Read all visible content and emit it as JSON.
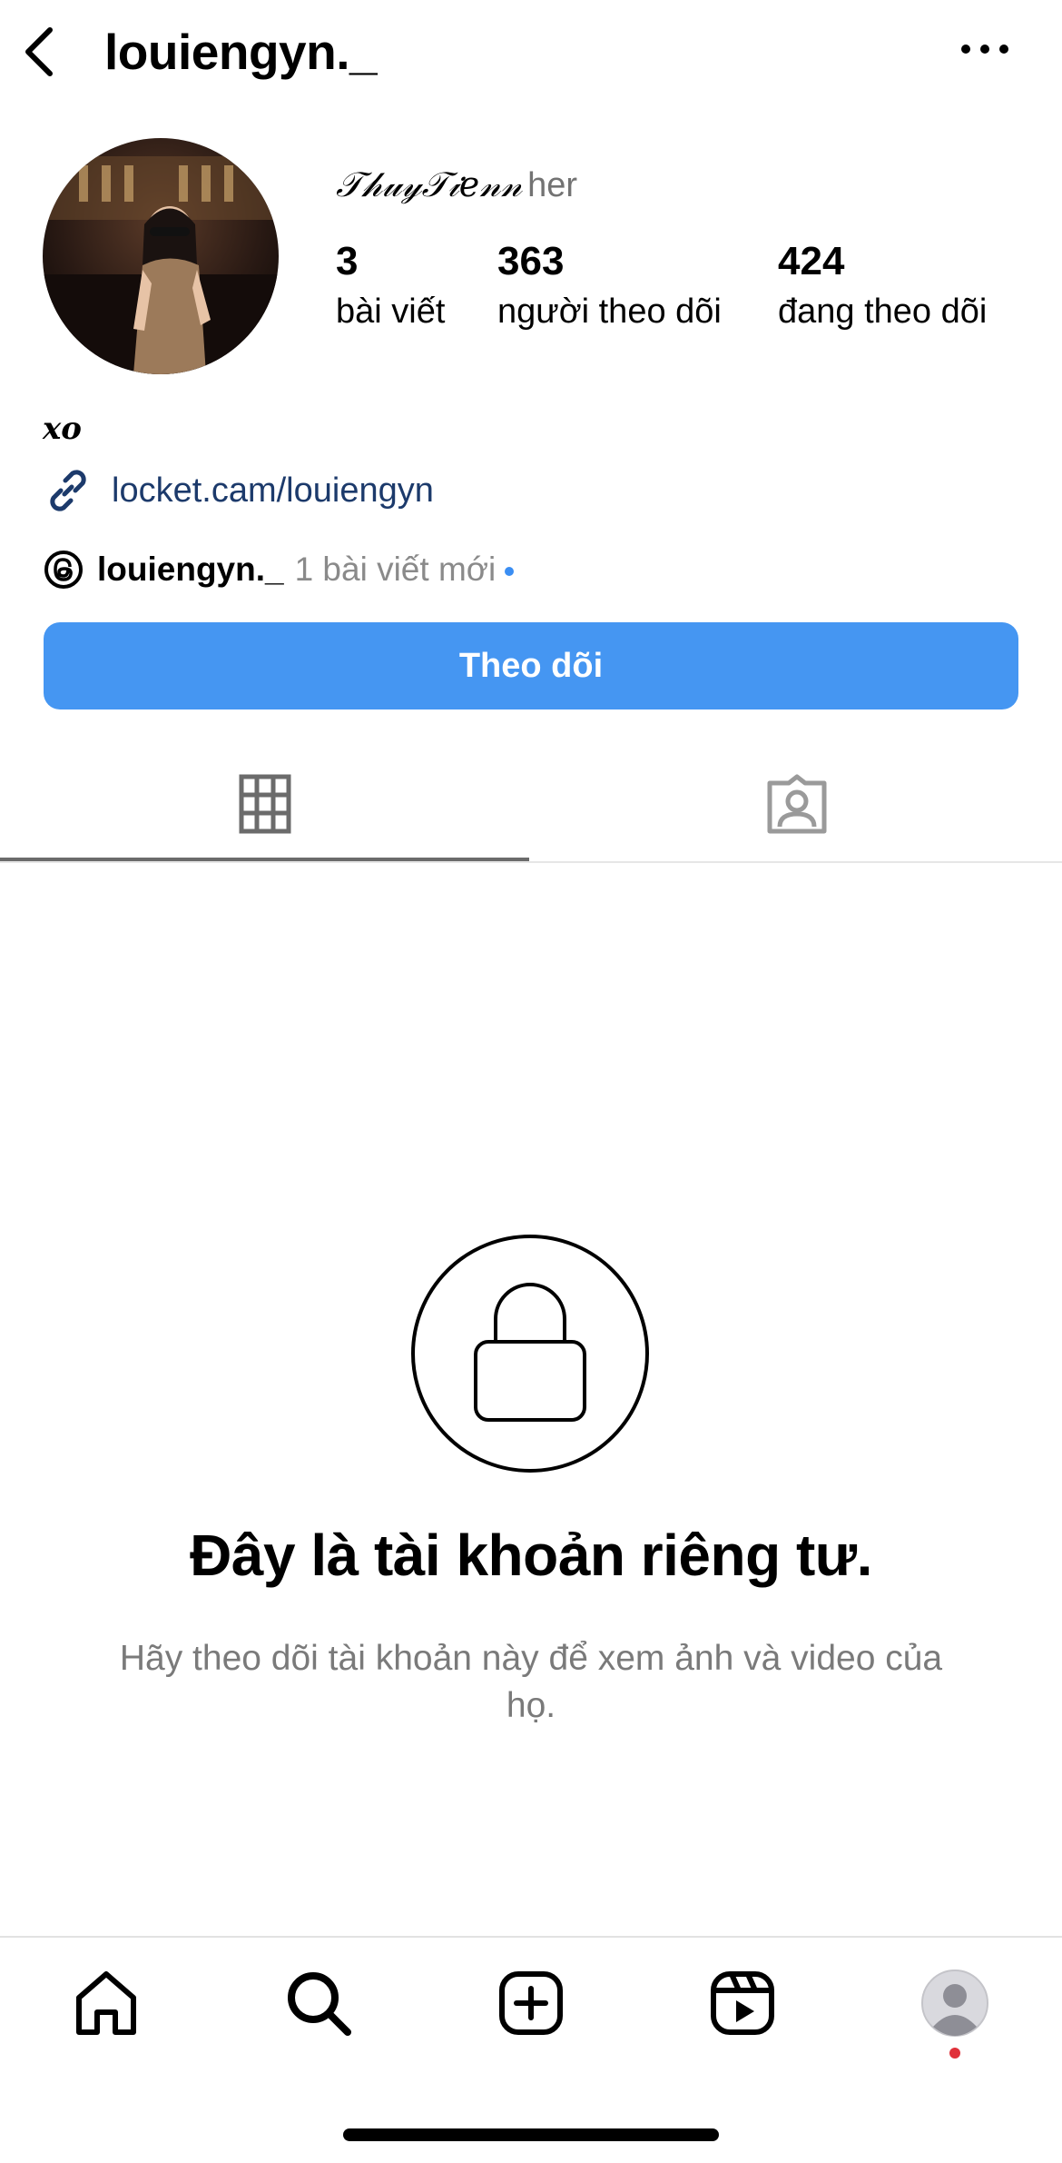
{
  "header": {
    "username": "louiengyn._"
  },
  "profile": {
    "display_name": "𝒯𝒽𝓊𝓎𝒯𝒾𝑒𝓃𝓃",
    "pronoun": "her",
    "stats": [
      {
        "value": "3",
        "label": "bài viết"
      },
      {
        "value": "363",
        "label": "người theo dõi"
      },
      {
        "value": "424",
        "label": "đang theo dõi"
      }
    ],
    "bio": "𝒙𝒐",
    "link": "locket.cam/louiengyn",
    "threads": {
      "name": "louiengyn._",
      "new_posts": "1 bài viết mới"
    },
    "follow_label": "Theo dõi"
  },
  "private": {
    "title": "Đây là tài khoản riêng tư.",
    "subtitle": "Hãy theo dõi tài khoản này để xem ảnh và video của họ."
  },
  "colors": {
    "accent": "#4596f2",
    "link": "#1c3a6b",
    "notification_dot": "#e0313a"
  },
  "icons": {
    "back": "chevron-left-icon",
    "more": "more-horizontal-icon",
    "grid": "grid-icon",
    "tagged": "tagged-user-icon",
    "lock": "lock-icon",
    "home": "home-icon",
    "search": "search-icon",
    "create": "create-plus-icon",
    "reels": "reels-icon",
    "profile": "profile-avatar-icon"
  }
}
